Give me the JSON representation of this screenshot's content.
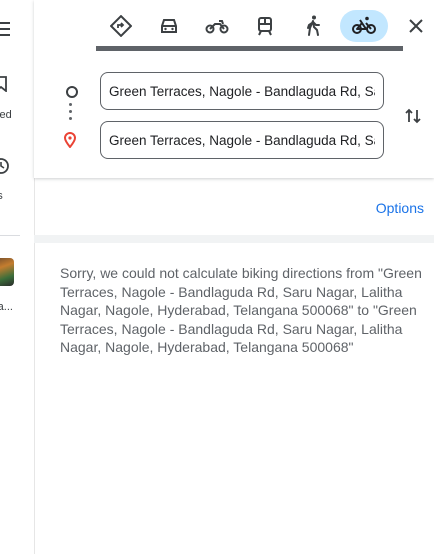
{
  "rail": {
    "saved_label": "ved",
    "recents_label": "ents",
    "thumb_label": "ra..."
  },
  "travel_modes": [
    {
      "name": "best-route",
      "icon": "diamond-route-icon",
      "active": false
    },
    {
      "name": "driving",
      "icon": "car-icon",
      "active": false
    },
    {
      "name": "two-wheeler",
      "icon": "motorcycle-icon",
      "active": false
    },
    {
      "name": "transit",
      "icon": "train-icon",
      "active": false
    },
    {
      "name": "walking",
      "icon": "walking-icon",
      "active": false
    },
    {
      "name": "cycling",
      "icon": "bicycle-icon",
      "active": true
    }
  ],
  "progress": {
    "value": 1.0
  },
  "directions": {
    "origin_value": "Green Terraces, Nagole - Bandlaguda Rd, Saru Nagar",
    "destination_value": "Green Terraces, Nagole - Bandlaguda Rd, Saru Nagar"
  },
  "options_label": "Options",
  "error_message": "Sorry, we could not calculate biking directions from \"Green Terraces, Nagole - Bandlaguda Rd, Saru Nagar, Lalitha Nagar, Nagole, Hyderabad, Telangana 500068\" to \"Green Terraces, Nagole - Bandlaguda Rd, Saru Nagar, Lalitha Nagar, Nagole, Hyderabad, Telangana 500068\"",
  "colors": {
    "accent": "#1a73e8",
    "active_mode_bg": "#c2e7ff",
    "destination_pin": "#ea4335"
  }
}
